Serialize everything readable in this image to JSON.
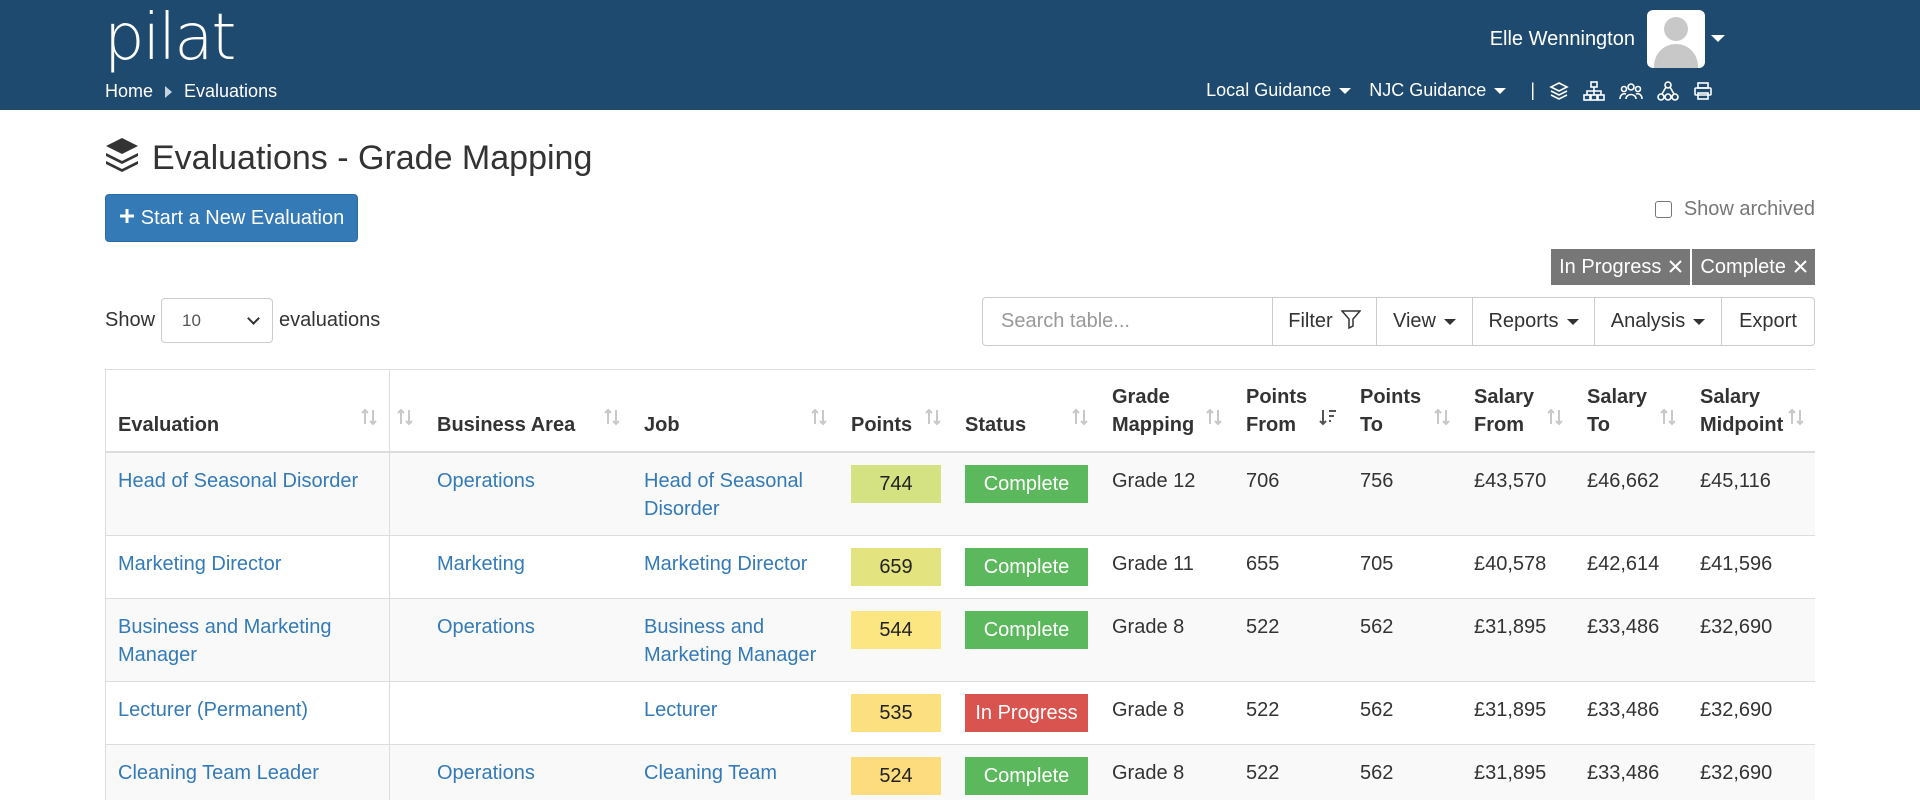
{
  "header": {
    "logo": "pilat",
    "breadcrumb": [
      "Home",
      "Evaluations"
    ],
    "user_name": "Elle Wennington",
    "guides": [
      "Local Guidance",
      "NJC Guidance"
    ],
    "separator": "|",
    "tool_icons": [
      "layers-icon",
      "org-chart-icon",
      "group-icon",
      "network-icon",
      "print-icon"
    ]
  },
  "page": {
    "title": "Evaluations - Grade Mapping",
    "new_button": "Start a New Evaluation",
    "show_archived": "Show archived",
    "filter_chips": [
      "In Progress",
      "Complete"
    ],
    "show_label": "Show",
    "page_length": "10",
    "evaluations_label": "evaluations"
  },
  "toolbar": {
    "search_placeholder": "Search table...",
    "filter": "Filter",
    "view": "View",
    "reports": "Reports",
    "analysis": "Analysis",
    "export": "Export"
  },
  "table": {
    "headers": {
      "evaluation": "Evaluation",
      "business_area": "Business Area",
      "job": "Job",
      "points": "Points",
      "status": "Status",
      "grade_mapping_1": "Grade",
      "grade_mapping_2": "Mapping",
      "points_from_1": "Points",
      "points_from_2": "From",
      "points_to_1": "Points",
      "points_to_2": "To",
      "salary_from_1": "Salary",
      "salary_from_2": "From",
      "salary_to_1": "Salary",
      "salary_to_2": "To",
      "salary_mid_1": "Salary",
      "salary_mid_2": "Midpoint"
    },
    "rows": [
      {
        "evaluation": "Head of Seasonal Disorder",
        "business_area": "Operations",
        "job": "Head of Seasonal Disorder",
        "points": "744",
        "points_color": "#d4e281",
        "status": "Complete",
        "status_color": "#5cb85c",
        "grade": "Grade 12",
        "points_from": "706",
        "points_to": "756",
        "salary_from": "£43,570",
        "salary_to": "£46,662",
        "salary_mid": "£45,116"
      },
      {
        "evaluation": "Marketing Director",
        "business_area": "Marketing",
        "job": "Marketing Director",
        "points": "659",
        "points_color": "#e3e47f",
        "status": "Complete",
        "status_color": "#5cb85c",
        "grade": "Grade 11",
        "points_from": "655",
        "points_to": "705",
        "salary_from": "£40,578",
        "salary_to": "£42,614",
        "salary_mid": "£41,596"
      },
      {
        "evaluation": "Business and Marketing Manager",
        "business_area": "Operations",
        "job": "Business and Marketing Manager",
        "points": "544",
        "points_color": "#fbe681",
        "status": "Complete",
        "status_color": "#5cb85c",
        "grade": "Grade 8",
        "points_from": "522",
        "points_to": "562",
        "salary_from": "£31,895",
        "salary_to": "£33,486",
        "salary_mid": "£32,690"
      },
      {
        "evaluation": "Lecturer (Permanent)",
        "business_area": "",
        "job": "Lecturer",
        "points": "535",
        "points_color": "#fcdf7e",
        "status": "In Progress",
        "status_color": "#d9534f",
        "grade": "Grade 8",
        "points_from": "522",
        "points_to": "562",
        "salary_from": "£31,895",
        "salary_to": "£33,486",
        "salary_mid": "£32,690"
      },
      {
        "evaluation": "Cleaning Team Leader",
        "business_area": "Operations",
        "job": "Cleaning Team",
        "points": "524",
        "points_color": "#fcdc7d",
        "status": "Complete",
        "status_color": "#5cb85c",
        "grade": "Grade 8",
        "points_from": "522",
        "points_to": "562",
        "salary_from": "£31,895",
        "salary_to": "£33,486",
        "salary_mid": "£32,690"
      }
    ]
  }
}
